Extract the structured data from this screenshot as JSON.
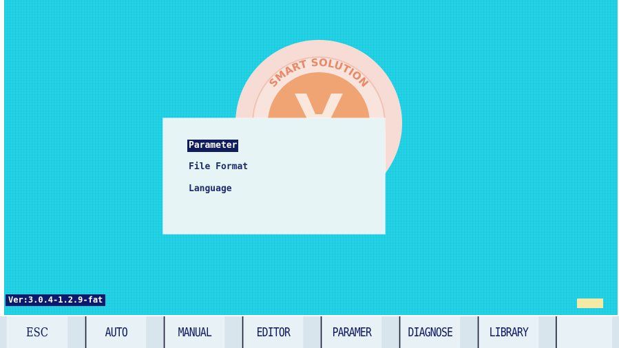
{
  "logo": {
    "arc_text": "SMART SOLUTION"
  },
  "dialog": {
    "items": [
      {
        "label": "Parameter",
        "selected": true
      },
      {
        "label": "File Format",
        "selected": false
      },
      {
        "label": "Language",
        "selected": false
      }
    ]
  },
  "status": {
    "version": "Ver:3.0.4-1.2.9-fat"
  },
  "bottom_bar": {
    "keys": [
      "ESC",
      "AUTO",
      "MANUAL",
      "EDITOR",
      "PARAMER",
      "DIAGNOSE",
      "LIBRARY",
      ""
    ]
  },
  "colors": {
    "background": "#22d2e6",
    "dialog": "#e6f4f6",
    "selection": "#101c5e",
    "logo_orange": "#f0a070"
  }
}
